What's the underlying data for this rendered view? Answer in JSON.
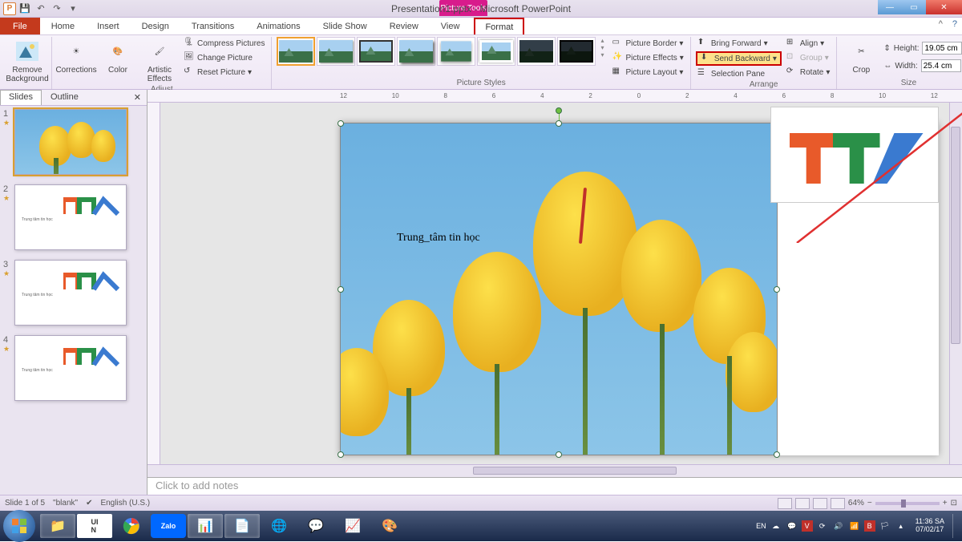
{
  "window": {
    "title": "Presentation1.pptx - Microsoft PowerPoint",
    "context_label": "Picture Tools"
  },
  "qat": {
    "save": "💾",
    "undo": "↶",
    "redo": "↷"
  },
  "tabs": {
    "file": "File",
    "home": "Home",
    "insert": "Insert",
    "design": "Design",
    "transitions": "Transitions",
    "animations": "Animations",
    "slideshow": "Slide Show",
    "review": "Review",
    "view": "View",
    "format": "Format"
  },
  "ribbon": {
    "remove_bg": "Remove Background",
    "corrections": "Corrections",
    "color": "Color",
    "artistic": "Artistic Effects",
    "compress": "Compress Pictures",
    "change": "Change Picture",
    "reset": "Reset Picture",
    "adjust_label": "Adjust",
    "styles_label": "Picture Styles",
    "border": "Picture Border",
    "effects": "Picture Effects",
    "layout": "Picture Layout",
    "bring_fwd": "Bring Forward",
    "send_back": "Send Backward",
    "sel_pane": "Selection Pane",
    "align": "Align",
    "group": "Group",
    "rotate": "Rotate",
    "arrange_label": "Arrange",
    "crop": "Crop",
    "height_lbl": "Height:",
    "width_lbl": "Width:",
    "height_val": "19.05 cm",
    "width_val": "25.4 cm",
    "size_label": "Size"
  },
  "leftpane": {
    "slides_tab": "Slides",
    "outline_tab": "Outline",
    "slides": [
      {
        "num": "1"
      },
      {
        "num": "2"
      },
      {
        "num": "3"
      },
      {
        "num": "4"
      }
    ]
  },
  "slide": {
    "text_overlay": "Trung_tâm tin học"
  },
  "ruler_ticks": [
    "12",
    "10",
    "8",
    "6",
    "4",
    "2",
    "0",
    "2",
    "4",
    "6",
    "8",
    "10",
    "12"
  ],
  "notes": {
    "placeholder": "Click to add notes"
  },
  "status": {
    "slide_info": "Slide 1 of 5",
    "theme": "\"blank\"",
    "lang": "English (U.S.)",
    "zoom": "64%"
  },
  "taskbar": {
    "lang_ind": "EN",
    "time": "11:36 SA",
    "date": "07/02/17"
  }
}
